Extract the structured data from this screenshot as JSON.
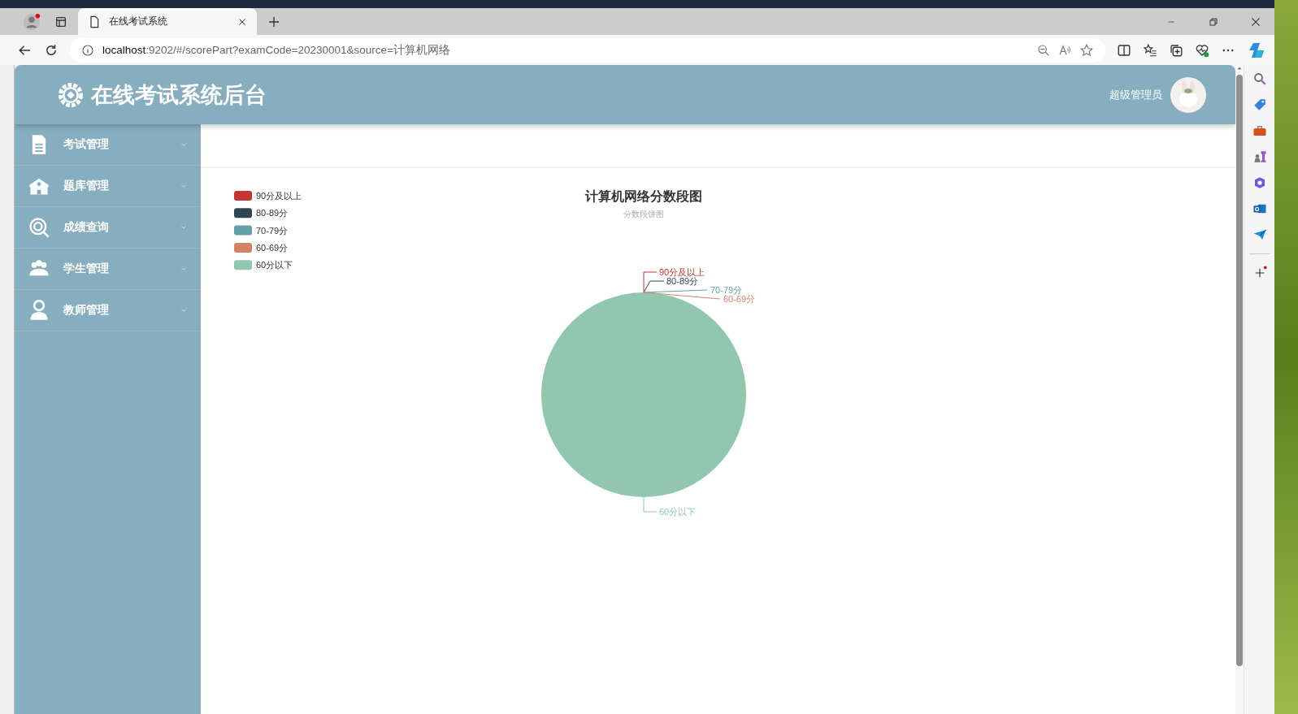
{
  "browser": {
    "tab_title": "在线考试系统",
    "url_host": "localhost",
    "url_rest": ":9202/#/scorePart?examCode=20230001&source=计算机网络"
  },
  "header": {
    "title": "在线考试系统后台",
    "user": "超级管理员"
  },
  "sidebar": {
    "items": [
      {
        "label": "考试管理"
      },
      {
        "label": "题库管理"
      },
      {
        "label": "成绩查询"
      },
      {
        "label": "学生管理"
      },
      {
        "label": "教师管理"
      }
    ]
  },
  "chart": {
    "subtitle": "分数段饼图",
    "legend": [
      {
        "label": "90分及以上",
        "color": "#c23531"
      },
      {
        "label": "80-89分",
        "color": "#2f4554"
      },
      {
        "label": "70-79分",
        "color": "#61a0a8"
      },
      {
        "label": "60-69分",
        "color": "#d48265"
      },
      {
        "label": "60分以下",
        "color": "#91c7ae"
      }
    ],
    "chart_data": {
      "type": "pie",
      "title": "计算机网络分数段图",
      "categories": [
        "90分及以上",
        "80-89分",
        "70-79分",
        "60-69分",
        "60分以下"
      ],
      "values": [
        0,
        0,
        0,
        0,
        1
      ]
    }
  }
}
